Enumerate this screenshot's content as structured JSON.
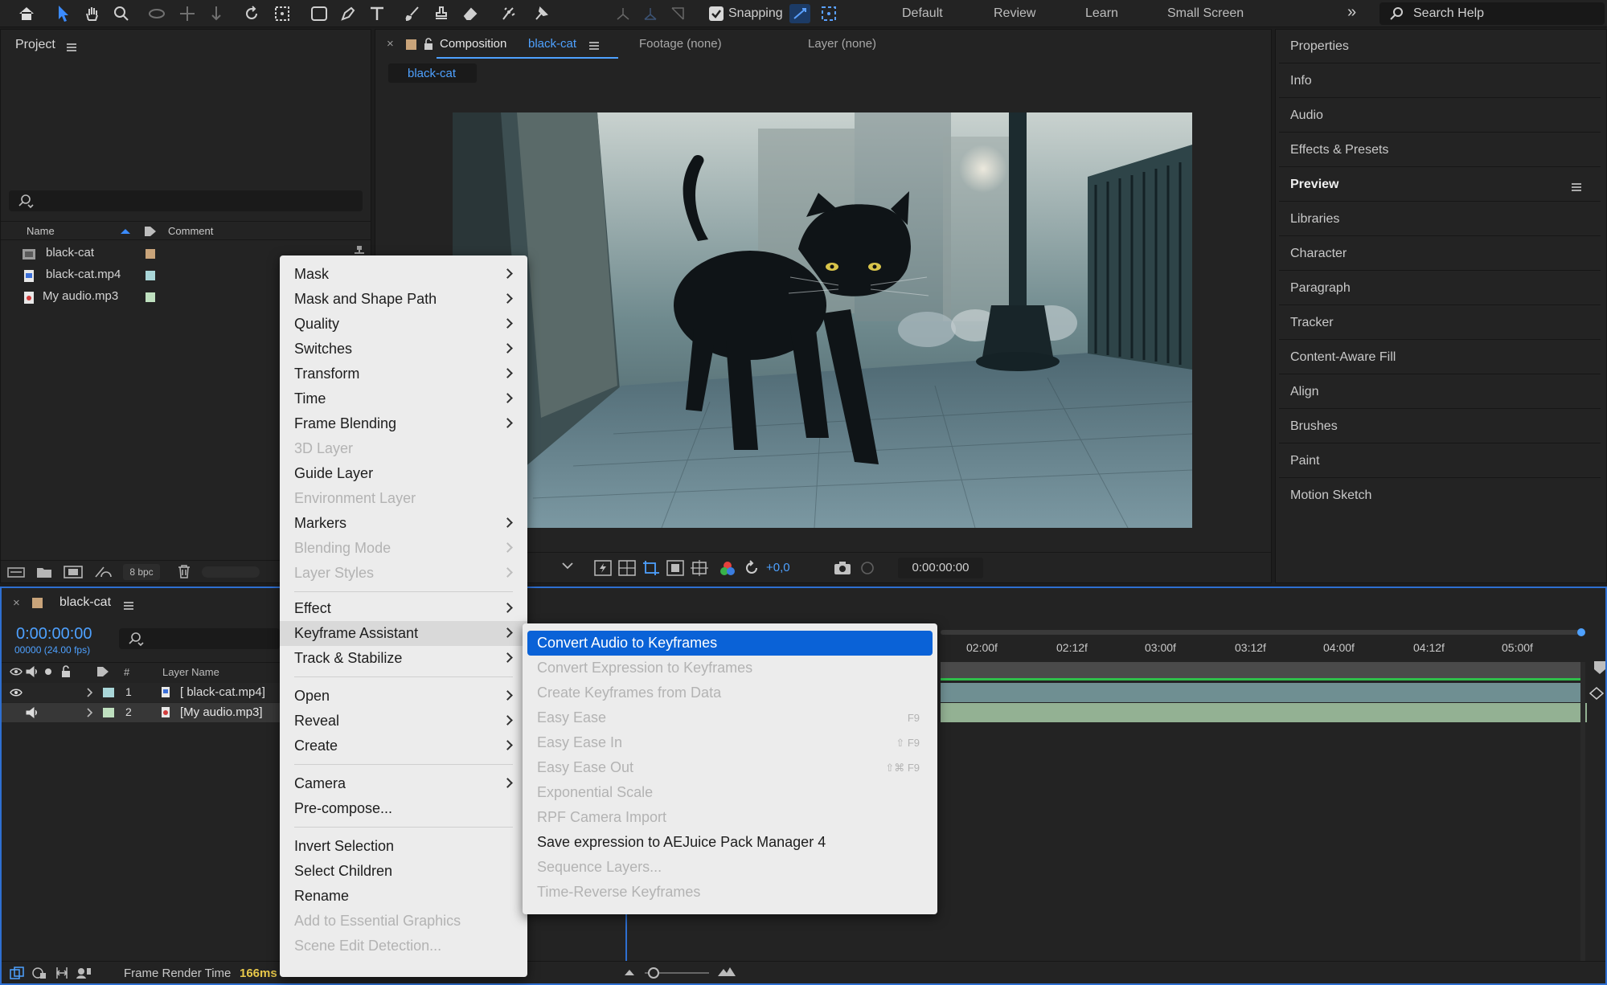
{
  "toolbar": {
    "snapping_label": "Snapping",
    "workspaces": [
      "Default",
      "Review",
      "Learn",
      "Small Screen"
    ],
    "search_placeholder": "Search Help",
    "more_icon": "double-chevron-right-icon"
  },
  "project": {
    "title": "Project",
    "columns": {
      "name": "Name",
      "comment": "Comment"
    },
    "items": [
      {
        "name": "black-cat",
        "icon": "composition-icon",
        "color": "#c9a47a"
      },
      {
        "name": "black-cat.mp4",
        "icon": "footage-icon",
        "color": "#a9d6d8"
      },
      {
        "name": "My audio.mp3",
        "icon": "audio-file-icon",
        "color": "#bfe0bf"
      }
    ],
    "bit_depth": "8 bpc"
  },
  "composition": {
    "tabs": {
      "composition_prefix": "Composition",
      "composition_name": "black-cat",
      "footage": "Footage (none)",
      "layer": "Layer (none)"
    },
    "subtab": "black-cat",
    "exposure": "+0,0",
    "timecode": "0:00:00:00"
  },
  "right_panel": {
    "items": [
      "Properties",
      "Info",
      "Audio",
      "Effects & Presets",
      "Preview",
      "Libraries",
      "Character",
      "Paragraph",
      "Tracker",
      "Content-Aware Fill",
      "Align",
      "Brushes",
      "Paint",
      "Motion Sketch"
    ],
    "active": "Preview"
  },
  "timeline": {
    "comp_name": "black-cat",
    "timecode": "0:00:00:00",
    "frame_info": "00000 (24.00 fps)",
    "columns": {
      "number": "#",
      "layer_name": "Layer Name"
    },
    "layers": [
      {
        "index": "1",
        "name": "[ black-cat.mp4]",
        "color": "#a9d6d8"
      },
      {
        "index": "2",
        "name": "[My audio.mp3]",
        "color": "#bfe0bf"
      }
    ],
    "ruler": [
      "02:00f",
      "02:12f",
      "03:00f",
      "03:12f",
      "04:00f",
      "04:12f",
      "05:00f"
    ],
    "frame_render_label": "Frame Render Time",
    "frame_render_value": "166ms"
  },
  "context_menu": {
    "items": [
      {
        "label": "Mask",
        "submenu": true,
        "enabled": true
      },
      {
        "label": "Mask and Shape Path",
        "submenu": true,
        "enabled": true
      },
      {
        "label": "Quality",
        "submenu": true,
        "enabled": true
      },
      {
        "label": "Switches",
        "submenu": true,
        "enabled": true
      },
      {
        "label": "Transform",
        "submenu": true,
        "enabled": true
      },
      {
        "label": "Time",
        "submenu": true,
        "enabled": true
      },
      {
        "label": "Frame Blending",
        "submenu": true,
        "enabled": true
      },
      {
        "label": "3D Layer",
        "submenu": false,
        "enabled": false
      },
      {
        "label": "Guide Layer",
        "submenu": false,
        "enabled": true
      },
      {
        "label": "Environment Layer",
        "submenu": false,
        "enabled": false
      },
      {
        "label": "Markers",
        "submenu": true,
        "enabled": true
      },
      {
        "label": "Blending Mode",
        "submenu": true,
        "enabled": false
      },
      {
        "label": "Layer Styles",
        "submenu": true,
        "enabled": false
      },
      {
        "label": "Effect",
        "submenu": true,
        "enabled": true
      },
      {
        "label": "Keyframe Assistant",
        "submenu": true,
        "enabled": true,
        "highlighted": true
      },
      {
        "label": "Track & Stabilize",
        "submenu": true,
        "enabled": true
      },
      {
        "label": "Open",
        "submenu": true,
        "enabled": true
      },
      {
        "label": "Reveal",
        "submenu": true,
        "enabled": true
      },
      {
        "label": "Create",
        "submenu": true,
        "enabled": true
      },
      {
        "label": "Camera",
        "submenu": true,
        "enabled": true
      },
      {
        "label": "Pre-compose...",
        "submenu": false,
        "enabled": true
      },
      {
        "label": "Invert Selection",
        "submenu": false,
        "enabled": true
      },
      {
        "label": "Select Children",
        "submenu": false,
        "enabled": true
      },
      {
        "label": "Rename",
        "submenu": false,
        "enabled": true
      },
      {
        "label": "Add to Essential Graphics",
        "submenu": false,
        "enabled": false
      },
      {
        "label": "Scene Edit Detection...",
        "submenu": false,
        "enabled": false
      }
    ]
  },
  "submenu": {
    "items": [
      {
        "label": "Convert Audio to Keyframes",
        "enabled": true,
        "selected": true,
        "shortcut": ""
      },
      {
        "label": "Convert Expression to Keyframes",
        "enabled": false,
        "shortcut": ""
      },
      {
        "label": "Create Keyframes from Data",
        "enabled": false,
        "shortcut": ""
      },
      {
        "label": "Easy Ease",
        "enabled": false,
        "shortcut": "F9"
      },
      {
        "label": "Easy Ease In",
        "enabled": false,
        "shortcut": "⇧ F9"
      },
      {
        "label": "Easy Ease Out",
        "enabled": false,
        "shortcut": "⇧⌘ F9"
      },
      {
        "label": "Exponential Scale",
        "enabled": false,
        "shortcut": ""
      },
      {
        "label": "RPF Camera Import",
        "enabled": false,
        "shortcut": ""
      },
      {
        "label": "Save expression to AEJuice Pack Manager 4",
        "enabled": true,
        "shortcut": ""
      },
      {
        "label": "Sequence Layers...",
        "enabled": false,
        "shortcut": ""
      },
      {
        "label": "Time-Reverse Keyframes",
        "enabled": false,
        "shortcut": ""
      }
    ]
  }
}
